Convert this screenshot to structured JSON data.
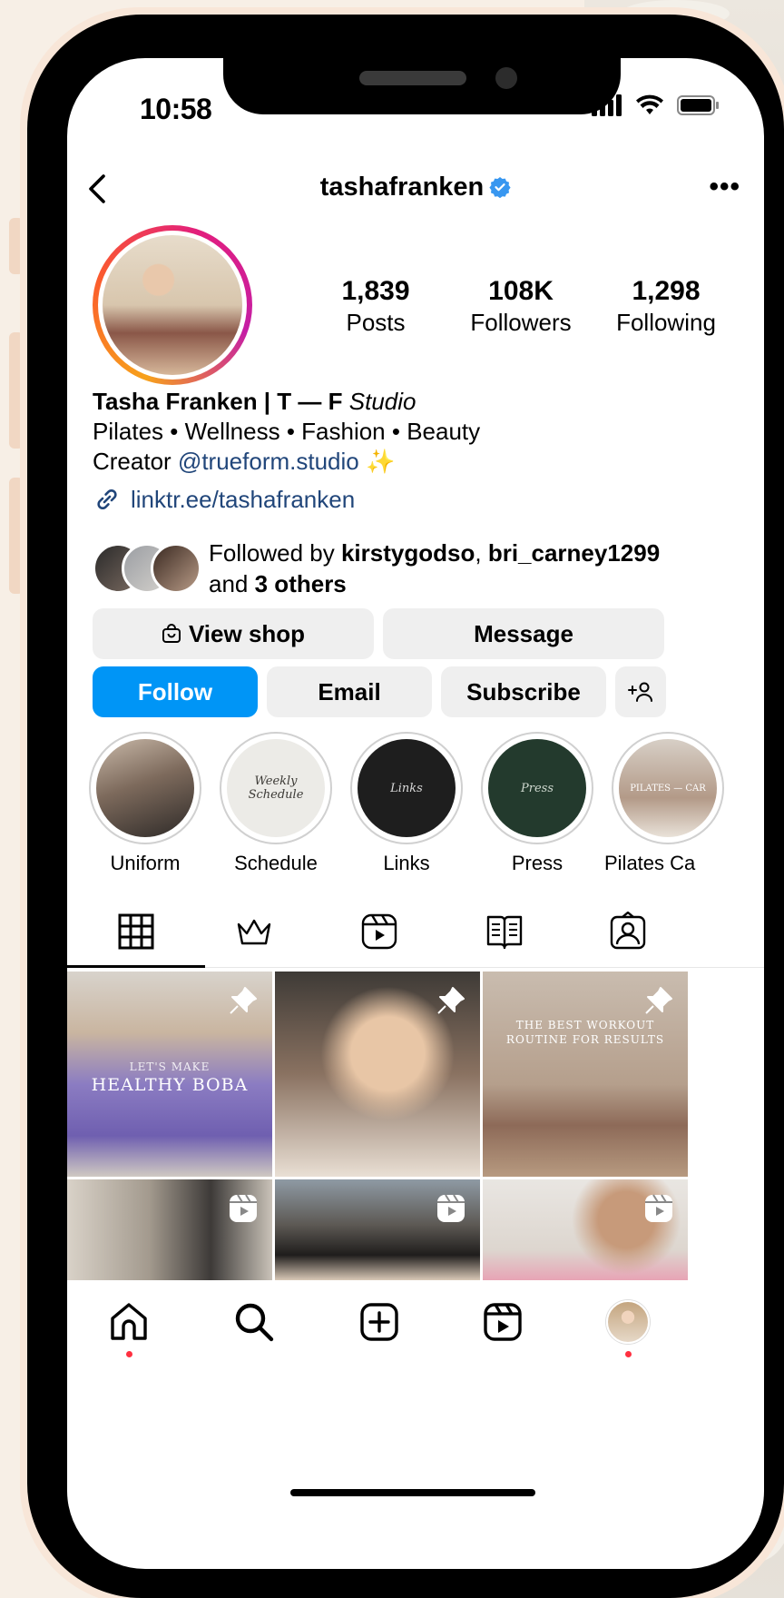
{
  "status_bar": {
    "time": "10:58"
  },
  "header": {
    "username": "tashafranken"
  },
  "stats": [
    {
      "value": "1,839",
      "label": "Posts"
    },
    {
      "value": "108K",
      "label": "Followers"
    },
    {
      "value": "1,298",
      "label": "Following"
    }
  ],
  "bio": {
    "name": "Tasha Franken | T — F",
    "name_italic": "Studio",
    "line1": "Pilates • Wellness • Fashion • Beauty",
    "line2_prefix": "Creator",
    "line2_handle": "@trueform.studio",
    "line2_emoji": "✨",
    "link": "linktr.ee/tashafranken"
  },
  "followed_by": {
    "prefix": "Followed by",
    "user1": "kirstygodso",
    "sep": ",",
    "user2": "bri_carney1299",
    "and": "and",
    "others": "3 others"
  },
  "buttons": {
    "view_shop": "View shop",
    "message": "Message",
    "follow": "Follow",
    "email": "Email",
    "subscribe": "Subscribe"
  },
  "highlights": [
    {
      "label": "Uniform",
      "cover_text": ""
    },
    {
      "label": "Schedule",
      "cover_text": "Weekly Schedule"
    },
    {
      "label": "Links",
      "cover_text": "Links"
    },
    {
      "label": "Press",
      "cover_text": "Press"
    },
    {
      "label": "Pilates Ca",
      "cover_text": "PILATES — CAR"
    }
  ],
  "posts": [
    {
      "overlay_small": "LET'S MAKE",
      "overlay_big": "HEALTHY BOBA"
    },
    {
      "overlay_small": "",
      "overlay_big": ""
    },
    {
      "overlay_small": "THE BEST WORKOUT",
      "overlay_big": "ROUTINE FOR RESULTS"
    }
  ],
  "colors": {
    "accent": "#0095f6",
    "link": "#21467a",
    "notification": "#ff3040",
    "verified": "#3897f0"
  }
}
